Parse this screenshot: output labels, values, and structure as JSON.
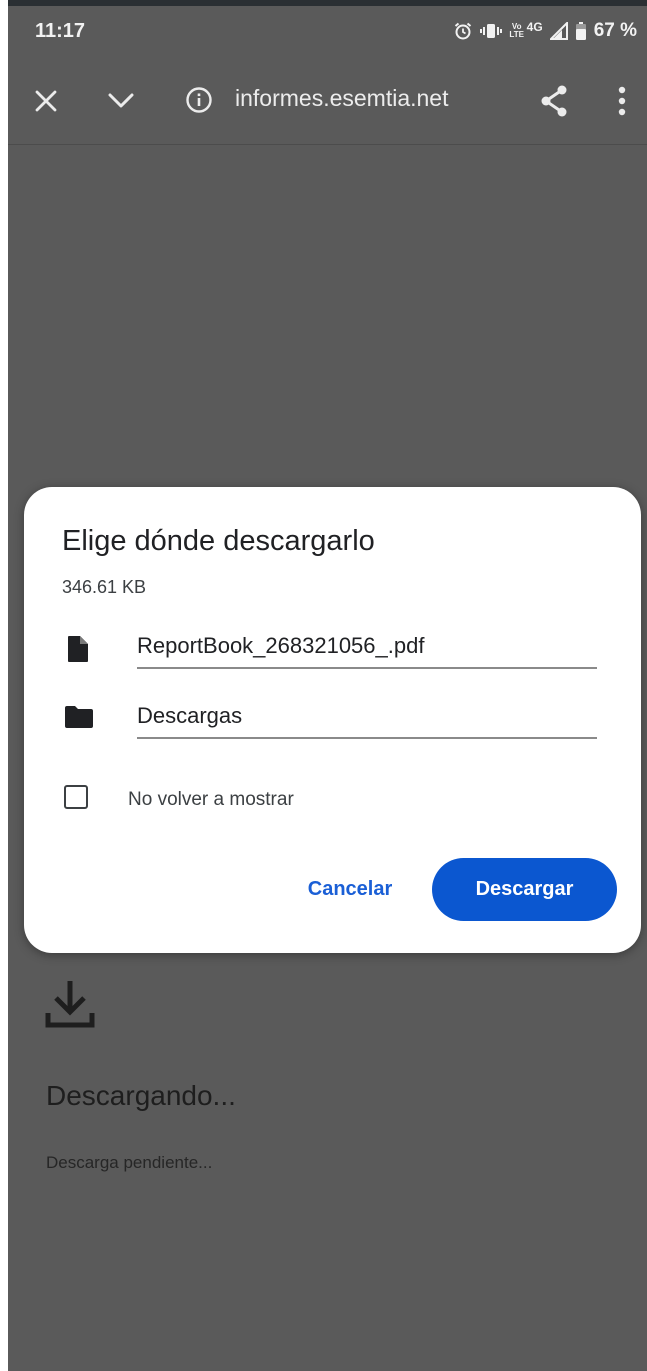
{
  "status_bar": {
    "time": "11:17",
    "volte": "Vo LTE",
    "network": "4G",
    "battery": "67 %",
    "icons": [
      "alarm-icon",
      "vibrate-icon",
      "signal-icon",
      "battery-icon"
    ]
  },
  "toolbar": {
    "url": "informes.esemtia.net",
    "icons": [
      "close-icon",
      "chevron-down-icon",
      "info-icon",
      "share-icon",
      "more-vert-icon"
    ]
  },
  "dialog": {
    "title": "Elige dónde descargarlo",
    "file_size": "346.61 KB",
    "file_name": "ReportBook_268321056_.pdf",
    "folder": "Descargas",
    "dont_show_again": {
      "label": "No volver a mostrar",
      "checked": false
    },
    "cancel_label": "Cancelar",
    "download_label": "Descargar"
  },
  "download_page": {
    "title": "Descargando...",
    "status": "Descarga pendiente..."
  },
  "colors": {
    "accent": "#0b57d0",
    "link": "#1a5fd6",
    "scrim": "#5a5a5a",
    "dialog_bg": "#ffffff"
  }
}
